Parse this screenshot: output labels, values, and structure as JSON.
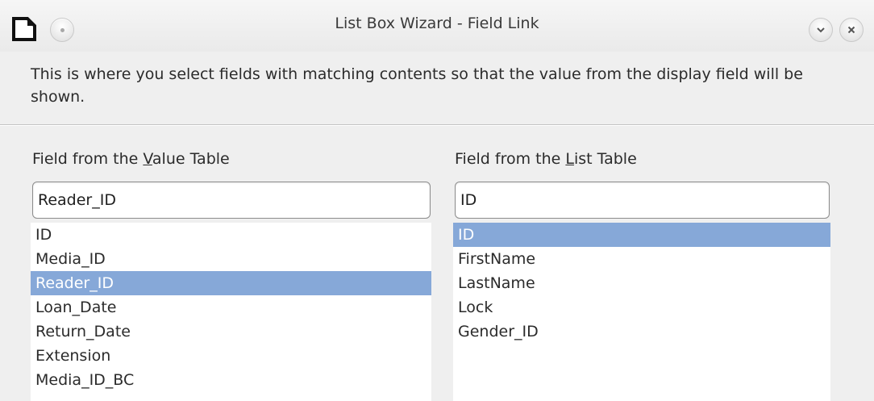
{
  "window": {
    "title": "List Box Wizard - Field Link",
    "icons": {
      "app": "document-app-icon",
      "menu": "window-menu-icon",
      "minimize": "chevron-down-icon",
      "close": "close-icon"
    }
  },
  "description": "This is where you select fields with matching contents so that the value from the display field will be shown.",
  "value_table": {
    "label_pre": "Field from the ",
    "label_mnemonic": "V",
    "label_post": "alue Table",
    "input_value": "Reader_ID",
    "items": [
      "ID",
      "Media_ID",
      "Reader_ID",
      "Loan_Date",
      "Return_Date",
      "Extension",
      "Media_ID_BC"
    ],
    "selected": "Reader_ID"
  },
  "list_table": {
    "label_pre": "Field from the ",
    "label_mnemonic": "L",
    "label_post": "ist Table",
    "input_value": "ID",
    "items": [
      "ID",
      "FirstName",
      "LastName",
      "Lock",
      "Gender_ID"
    ],
    "selected": "ID"
  },
  "colors": {
    "selection": "#86a8d8",
    "background": "#efefef"
  }
}
